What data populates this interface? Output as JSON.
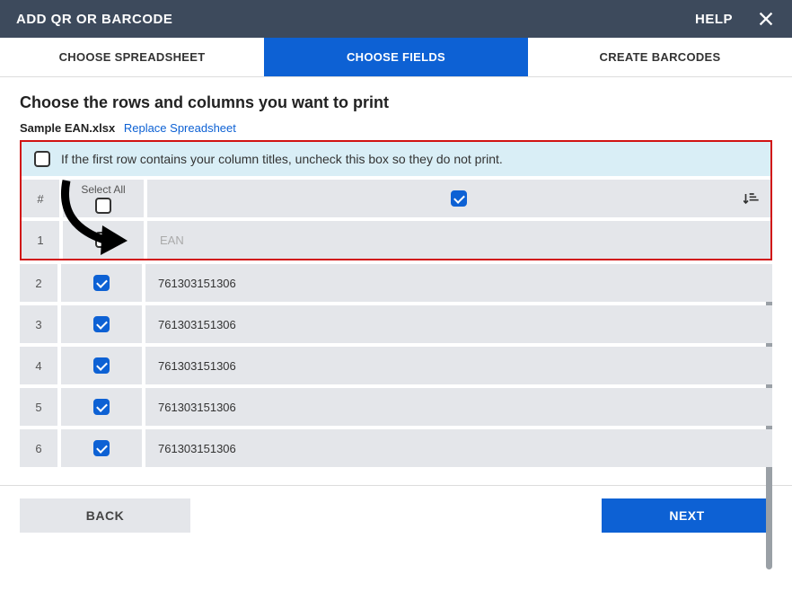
{
  "topbar": {
    "title": "ADD QR OR BARCODE",
    "help": "HELP"
  },
  "tabs": [
    {
      "label": "CHOOSE SPREADSHEET",
      "active": false
    },
    {
      "label": "CHOOSE FIELDS",
      "active": true
    },
    {
      "label": "CREATE BARCODES",
      "active": false
    }
  ],
  "heading": "Choose the rows and columns you want to print",
  "file": {
    "name": "Sample EAN.xlsx",
    "replace": "Replace Spreadsheet"
  },
  "info": {
    "text": "If the first row contains your column titles, uncheck this box so they do not print.",
    "checked": false
  },
  "header": {
    "num": "#",
    "select_all": "Select All",
    "select_all_checked": false,
    "col_checked": true
  },
  "rows": [
    {
      "num": "1",
      "checked": false,
      "value": "EAN",
      "muted": true
    },
    {
      "num": "2",
      "checked": true,
      "value": "761303151306",
      "muted": false
    },
    {
      "num": "3",
      "checked": true,
      "value": "761303151306",
      "muted": false
    },
    {
      "num": "4",
      "checked": true,
      "value": "761303151306",
      "muted": false
    },
    {
      "num": "5",
      "checked": true,
      "value": "761303151306",
      "muted": false
    },
    {
      "num": "6",
      "checked": true,
      "value": "761303151306",
      "muted": false
    }
  ],
  "footer": {
    "back": "BACK",
    "next": "NEXT"
  }
}
